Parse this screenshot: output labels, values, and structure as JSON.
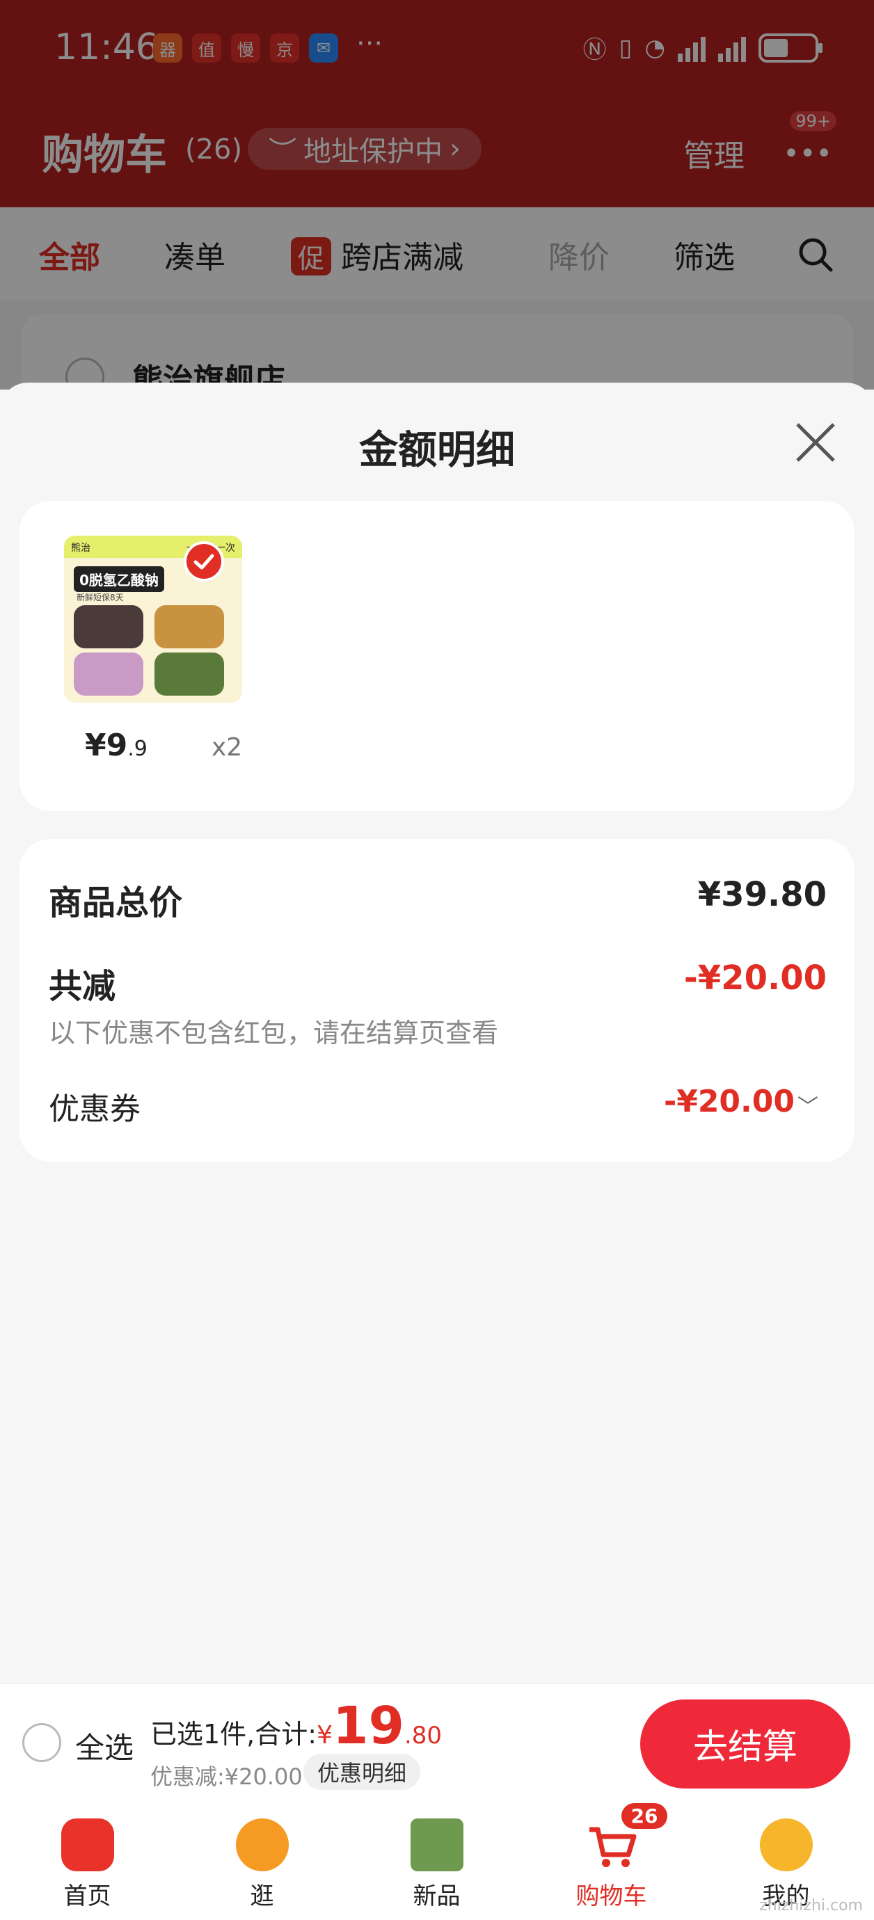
{
  "status_bar": {
    "time": "11:46",
    "apps": [
      "器",
      "值",
      "慢",
      "京",
      "✉"
    ],
    "more": "···"
  },
  "header": {
    "title": "购物车",
    "count": "(26)",
    "address_protection": "地址保护中",
    "manage": "管理",
    "more_badge": "99+"
  },
  "filters": {
    "all": "全部",
    "combine": "凑单",
    "promo_tag": "促",
    "cross_store": "跨店满减",
    "price_drop": "降价",
    "filter": "筛选"
  },
  "store": {
    "name": "熊治旗舰店"
  },
  "sheet": {
    "title": "金额明细",
    "product": {
      "image_banner_left": "熊治",
      "image_banner_right": "一周购一次",
      "image_headline": "0脱氢乙酸钠",
      "image_subline": "新鲜短保8天",
      "price_int": "¥9",
      "price_dec": ".9",
      "qty": "x2"
    },
    "summary": {
      "total_label": "商品总价",
      "total_value": "¥39.80",
      "reduce_label": "共减",
      "reduce_value": "-¥20.00",
      "reduce_note": "以下优惠不包含红包，请在结算页查看",
      "coupon_label": "优惠券",
      "coupon_value": "-¥20.00"
    }
  },
  "checkout": {
    "select_all": "全选",
    "selected_text": "已选1件,合计:",
    "currency": "¥",
    "amount_int": "19",
    "amount_dec": ".80",
    "discount": "优惠减:¥20.00",
    "detail_button": "优惠明细",
    "checkout_button": "去结算"
  },
  "tabs": [
    {
      "label": "首页",
      "icon": "home-icon",
      "color": "#e8322a"
    },
    {
      "label": "逛",
      "icon": "explore-icon",
      "color": "#f59a23"
    },
    {
      "label": "新品",
      "icon": "new-products-icon",
      "color": "#6e9a4f"
    },
    {
      "label": "购物车",
      "icon": "cart-icon",
      "color": "#e02e24",
      "badge": "26"
    },
    {
      "label": "我的",
      "icon": "profile-icon",
      "color": "#f7b52c"
    }
  ],
  "watermark": "zhizhizhi.com",
  "colors": {
    "brand_red": "#e02e24",
    "header_red": "#b51f1f",
    "checkout_red": "#f0293a"
  }
}
